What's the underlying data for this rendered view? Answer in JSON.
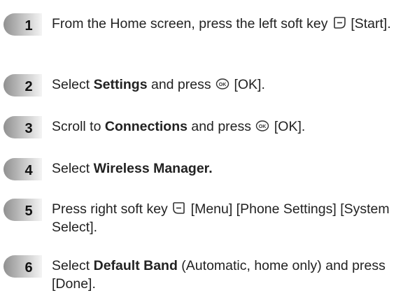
{
  "steps": [
    {
      "number": "1",
      "text_before": "From the Home screen, press the left soft key ",
      "icon": "left-soft-key-icon",
      "text_after": " [Start]."
    },
    {
      "number": "2",
      "text_before": "Select ",
      "bold": "Settings",
      "text_mid": " and press ",
      "icon": "ok-key-icon",
      "text_after": " [OK]."
    },
    {
      "number": "3",
      "text_before": "Scroll to ",
      "bold": "Connections",
      "text_mid": " and press ",
      "icon": "ok-key-icon",
      "text_after": " [OK]."
    },
    {
      "number": "4",
      "text_before": "Select ",
      "bold": "Wireless Manager."
    },
    {
      "number": "5",
      "text_before": "Press right soft key ",
      "icon": "right-soft-key-icon",
      "text_after": " [Menu] [Phone Settings] [System Select]."
    },
    {
      "number": "6",
      "text_before": "Select ",
      "bold": "Default Band",
      "text_after": " (Automatic, home only) and press [Done]."
    }
  ]
}
